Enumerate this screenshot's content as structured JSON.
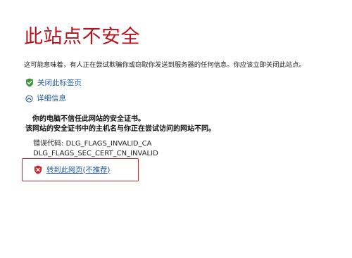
{
  "page": {
    "title": "此站点不安全",
    "description": "这可能意味着，有人正在尝试欺骗你或窃取你发送到服务器的任何信息。你应该立即关闭此站点。"
  },
  "links": {
    "close_tab": "关闭此标签页",
    "more_info": "详细信息",
    "goto_page": "转到此网页(不推荐)"
  },
  "details": {
    "line1": "你的电脑不信任此网站的安全证书。",
    "line2": "该网站的安全证书中的主机名与你正在尝试访问的网站不同。"
  },
  "error_codes": {
    "label": "错误代码:",
    "code1": "DLG_FLAGS_INVALID_CA",
    "code2": "DLG_FLAGS_SEC_CERT_CN_INVALID"
  },
  "colors": {
    "title_red": "#b5121b",
    "link_blue": "#1e5aa6",
    "highlight_red": "#d9232f",
    "shield_green": "#3a9a3a"
  },
  "icons": {
    "close_tab": "green-shield-check-icon",
    "more_info": "circle-chevron-up-icon",
    "goto_page": "red-shield-x-icon"
  }
}
